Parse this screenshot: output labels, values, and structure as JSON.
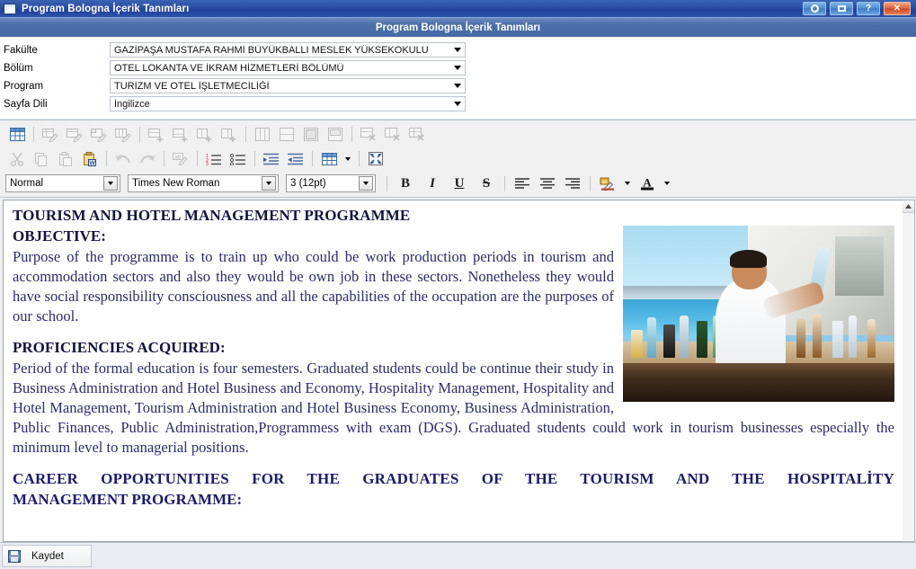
{
  "window": {
    "title": "Program Bologna İçerik Tanımları",
    "icon": "window-icon",
    "buttons": [
      {
        "name": "refresh-button",
        "label": ""
      },
      {
        "name": "restore-button",
        "label": ""
      },
      {
        "name": "help-button",
        "label": "?"
      },
      {
        "name": "close-button",
        "label": "✕"
      }
    ]
  },
  "section": {
    "header_title": "Program Bologna İçerik Tanımları"
  },
  "filters": [
    {
      "label": "Fakülte",
      "value": "GAZİPAŞA MUSTAFA RAHMİ BÜYÜKBALLI MESLEK YÜKSEKOKULU"
    },
    {
      "label": "Bölüm",
      "value": "OTEL LOKANTA VE İKRAM HİZMETLERİ BÖLÜMÜ"
    },
    {
      "label": "Program",
      "value": "TURİZM VE OTEL İŞLETMECİLİĞİ"
    },
    {
      "label": "Sayfa Dili",
      "value": "İngilizce"
    }
  ],
  "toolbar_table_row": [
    {
      "name": "insert-table-icon",
      "enabled": true
    },
    {
      "name": "table-properties-icon",
      "enabled": false
    },
    {
      "name": "row-properties-icon",
      "enabled": false
    },
    {
      "name": "cell-properties-icon",
      "enabled": false
    },
    {
      "name": "column-properties-icon",
      "enabled": false
    },
    {
      "name": "insert-row-above-icon",
      "enabled": false
    },
    {
      "name": "insert-row-below-icon",
      "enabled": false
    },
    {
      "name": "insert-column-left-icon",
      "enabled": false
    },
    {
      "name": "insert-column-right-icon",
      "enabled": false
    },
    {
      "name": "split-cell-vertical-icon",
      "enabled": false
    },
    {
      "name": "split-cell-horizontal-icon",
      "enabled": false
    },
    {
      "name": "merge-cells-icon",
      "enabled": false
    },
    {
      "name": "merge-cells-down-icon",
      "enabled": false
    },
    {
      "name": "delete-row-icon",
      "enabled": false
    },
    {
      "name": "delete-column-icon",
      "enabled": false
    },
    {
      "name": "delete-table-icon",
      "enabled": false
    }
  ],
  "toolbar_edit_row": [
    {
      "name": "cut-icon",
      "enabled": false
    },
    {
      "name": "copy-icon",
      "enabled": false
    },
    {
      "name": "paste-icon",
      "enabled": false
    },
    {
      "name": "paste-from-word-icon",
      "enabled": true
    },
    {
      "name": "undo-icon",
      "enabled": false
    },
    {
      "name": "redo-icon",
      "enabled": false
    },
    {
      "name": "spellcheck-icon",
      "enabled": false
    },
    {
      "name": "numbered-list-icon",
      "enabled": true
    },
    {
      "name": "bulleted-list-icon",
      "enabled": true
    },
    {
      "name": "indent-icon",
      "enabled": true
    },
    {
      "name": "outdent-icon",
      "enabled": true
    },
    {
      "name": "table-grid-icon",
      "enabled": true
    },
    {
      "name": "fullscreen-icon",
      "enabled": true
    }
  ],
  "format_bar": {
    "style": {
      "value": "Normal"
    },
    "font": {
      "value": "Times New Roman"
    },
    "size": {
      "value": "3 (12pt)"
    },
    "bold_label": "B",
    "italic_label": "I",
    "underline_label": "U",
    "strike_label": "S",
    "align_left_name": "align-left-icon",
    "align_center_name": "align-center-icon",
    "align_right_name": "align-right-icon",
    "highlight_name": "text-highlight-icon",
    "fontcolor_label": "A"
  },
  "document": {
    "title": "TOURISM AND HOTEL MANAGEMENT PROGRAMME",
    "subtitle": "OBJECTIVE:",
    "paragraph1": "Purpose of the programme is to train up who could be work production periods in tourism and accommodation sectors and also they would be own job in these sectors. Nonetheless they would have social responsibility consciousness and all the capabilities of the occupation are the purposes of our school.",
    "heading2": "PROFICIENCIES ACQUIRED:",
    "paragraph2": "Period of the formal education is four semesters. Graduated students could be continue their study in Business Administration and Hotel Business and Economy, Hospitality Management, Hospitality and Hotel Management, Tourism Administration and Hotel Business Economy, Business Administration, Public Finances, Public Administration,Programmess with exam (DGS). Graduated students could work in tourism businesses especially the minimum level to managerial positions.",
    "heading3_line1": "CAREER OPPORTUNITIES FOR THE GRADUATES OF THE TOURISM AND THE HOSPITALİTY",
    "heading3_line2": "MANAGEMENT PROGRAMME:",
    "image_alt": "bartender-photo"
  },
  "footer": {
    "save_label": "Kaydet"
  },
  "colors": {
    "titlebar": "#2b50a4",
    "section_header": "#4c6fa8",
    "close_button": "#cf4625",
    "document_text": "#2b2b6b",
    "toolbar_bg": "#f0f0f0"
  }
}
